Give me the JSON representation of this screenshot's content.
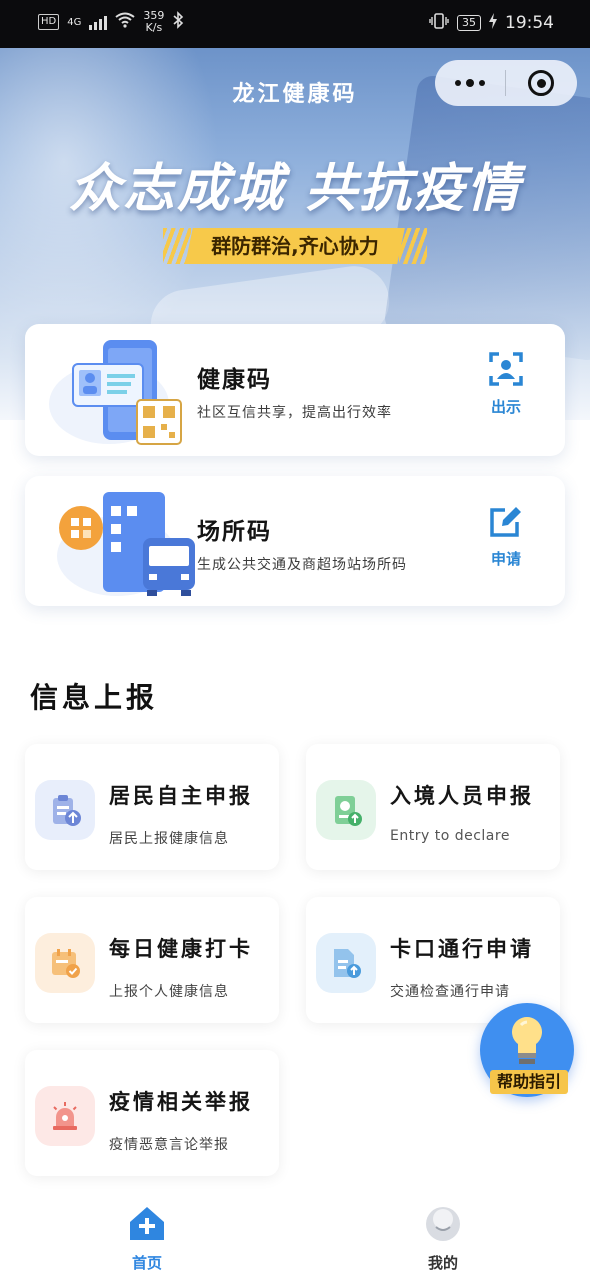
{
  "status_bar": {
    "hd_badge": "HD",
    "network": "4G",
    "speed_value": "359",
    "speed_unit": "K/s",
    "battery": "35",
    "time": "19:54"
  },
  "header": {
    "app_title": "龙江健康码",
    "slogan": "众志成城 共抗疫情",
    "ribbon_text": "群防群治,齐心协力"
  },
  "cards": {
    "health": {
      "title": "健康码",
      "subtitle": "社区互信共享，提高出行效率",
      "action_label": "出示",
      "action_icon": "scan-face-icon"
    },
    "place": {
      "title": "场所码",
      "subtitle": "生成公共交通及商超场站场所码",
      "action_label": "申请",
      "action_icon": "edit-icon"
    }
  },
  "info_report": {
    "section_title": "信息上报",
    "items": [
      {
        "title": "居民自主申报",
        "subtitle": "居民上报健康信息",
        "icon": "clipboard-upload-icon",
        "icon_bg": "#e8eefb",
        "icon_color": "#6d86d6"
      },
      {
        "title": "入境人员申报",
        "subtitle": "Entry to declare",
        "icon": "passport-upload-icon",
        "icon_bg": "#e5f5ea",
        "icon_color": "#45b06a"
      },
      {
        "title": "每日健康打卡",
        "subtitle": "上报个人健康信息",
        "icon": "calendar-check-icon",
        "icon_bg": "#fdeedd",
        "icon_color": "#f0a24a"
      },
      {
        "title": "卡口通行申请",
        "subtitle": "交通检查通行申请",
        "icon": "document-upload-icon",
        "icon_bg": "#e3f0fb",
        "icon_color": "#4a9bdc"
      },
      {
        "title": "疫情相关举报",
        "subtitle": "疫情恶意言论举报",
        "icon": "alarm-light-icon",
        "icon_bg": "#fde8e6",
        "icon_color": "#e86a60"
      }
    ]
  },
  "help_button": {
    "label": "帮助指引",
    "icon": "lightbulb-icon"
  },
  "tabbar": {
    "home_label": "首页",
    "mine_label": "我的"
  },
  "colors": {
    "accent_blue": "#2a86d4",
    "hero_blue": "#6d93c9",
    "ribbon_yellow": "#f7c94a"
  }
}
